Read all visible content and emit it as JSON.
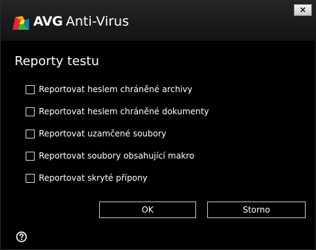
{
  "window": {
    "brand": "AVG",
    "product": "Anti-Virus",
    "close_label": "×",
    "logo_icon": "avg-logo-icon"
  },
  "colors": {
    "background": "#000000",
    "titlebar": "#1c1c1c",
    "text": "#ffffff",
    "logo_red": "#e5282d",
    "logo_orange": "#f7a21b",
    "logo_yellow": "#fff200",
    "logo_green": "#2fb34a",
    "logo_blue": "#1a76bc"
  },
  "page": {
    "title": "Reporty testu"
  },
  "options": [
    {
      "label": "Reportovat heslem chráněné archivy",
      "checked": false
    },
    {
      "label": "Reportovat heslem chráněné dokumenty",
      "checked": false
    },
    {
      "label": "Reportovat uzamčené soubory",
      "checked": false
    },
    {
      "label": "Reportovat soubory obsahující makro",
      "checked": false
    },
    {
      "label": "Reportovat skryté přípony",
      "checked": false
    }
  ],
  "buttons": {
    "ok_label": "OK",
    "cancel_label": "Storno"
  },
  "help": {
    "icon": "help-icon"
  }
}
